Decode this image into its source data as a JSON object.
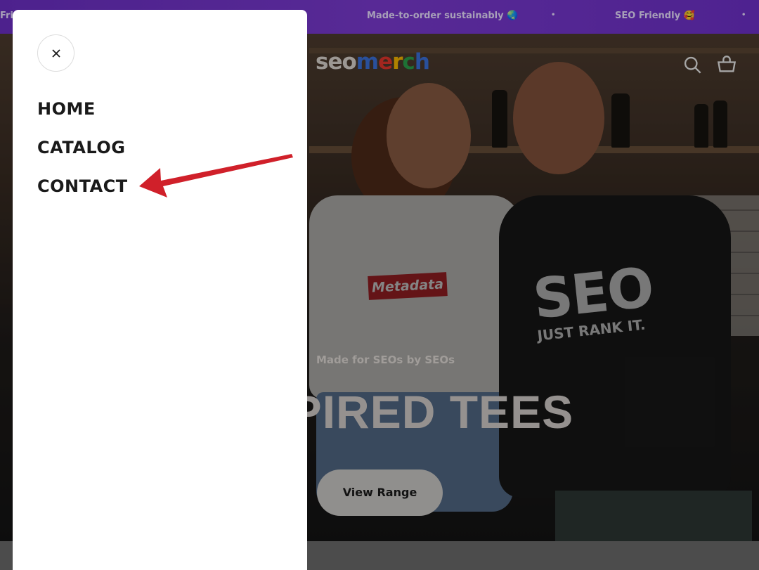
{
  "announcement": {
    "items": [
      "Fri",
      "Made-to-order sustainably 🌏",
      "SEO Friendly 🥰"
    ],
    "separator": "•"
  },
  "header": {
    "logo": {
      "part1": "seo",
      "part2": [
        "m",
        "e",
        "r",
        "c",
        "h"
      ]
    },
    "logo_colors": [
      "#3a6fd8",
      "#e0352b",
      "#f4b400",
      "#2a9d4a",
      "#3a6fd8"
    ],
    "icons": [
      "search-icon",
      "cart-icon"
    ]
  },
  "hero": {
    "subtitle": "Made for SEOs by SEOs",
    "title": "NSPIRED TEES",
    "button_label": "View Range",
    "shirt_left_text": "Metadata",
    "shirt_right_text_big": "SEO",
    "shirt_right_text_small": "JUST RANK IT."
  },
  "drawer": {
    "close_icon": "close-icon",
    "nav": [
      "HOME",
      "CATALOG",
      "CONTACT"
    ],
    "annotation": "red-arrow-pointing-to-contact",
    "annotation_color": "#d0202a"
  }
}
